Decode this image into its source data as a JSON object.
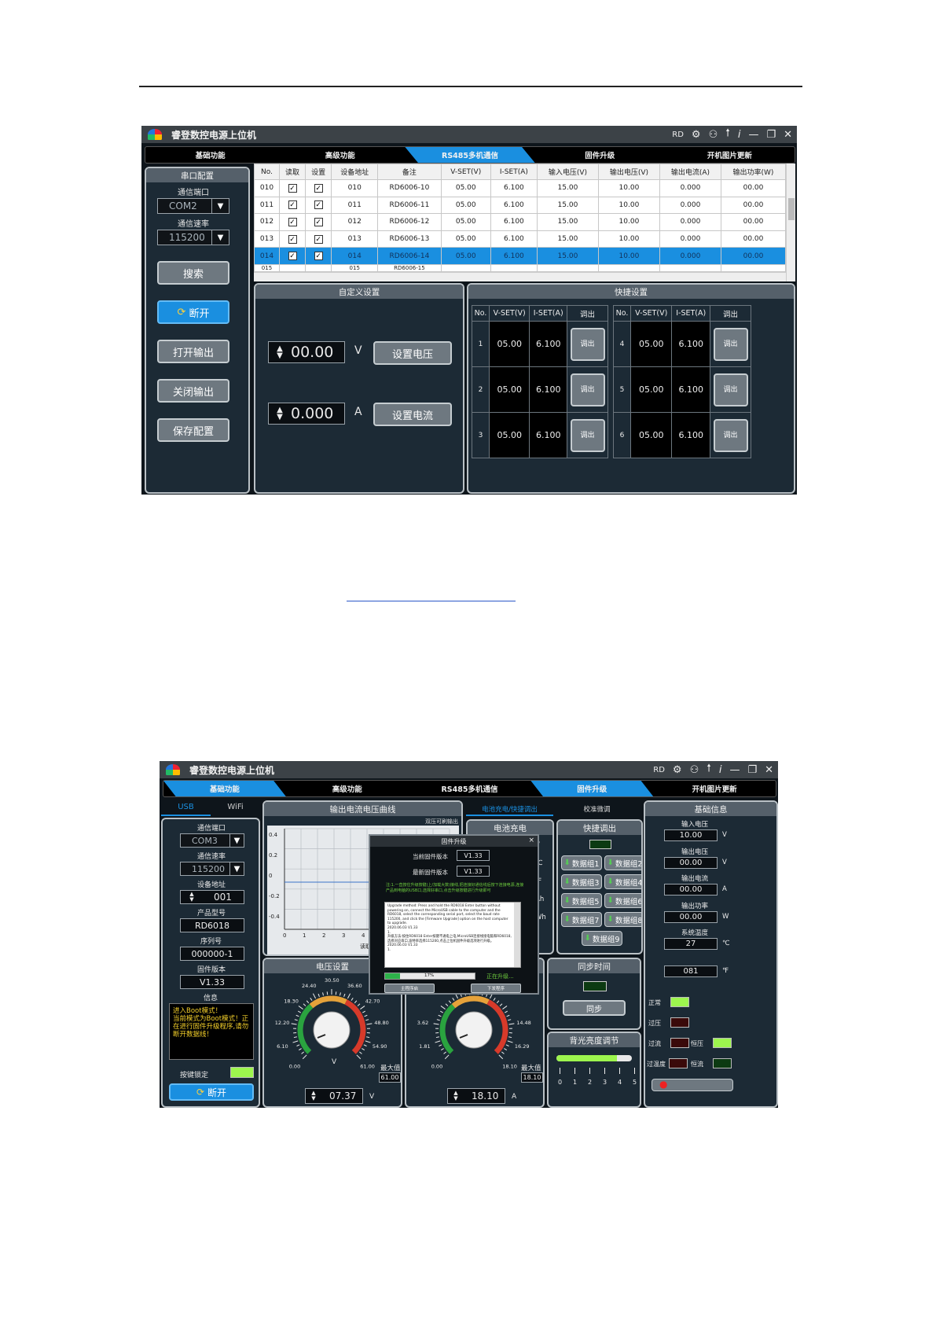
{
  "shot1": {
    "app_title": "睿登数控电源上位机",
    "window_controls": {
      "rd": "RD",
      "settings": "⚙",
      "user": "⚇",
      "upload": "🠕",
      "info": "i",
      "min": "—",
      "restore": "❐",
      "close": "✕"
    },
    "tabs": [
      "基础功能",
      "高级功能",
      "RS485多机通信",
      "固件升级",
      "开机图片更新"
    ],
    "serial": {
      "header": "串口配置",
      "port_label": "通信端口",
      "port_value": "COM2",
      "baud_label": "通信速率",
      "baud_value": "115200",
      "search": "搜索",
      "disconnect": "断开",
      "open_output": "打开输出",
      "close_output": "关闭输出",
      "save_config": "保存配置"
    },
    "grid": {
      "columns": [
        "No.",
        "读取",
        "设置",
        "设备地址",
        "备注",
        "V-SET(V)",
        "I-SET(A)",
        "输入电压(V)",
        "输出电压(V)",
        "输出电流(A)",
        "输出功率(W)"
      ],
      "rows": [
        [
          "010",
          "✓",
          "✓",
          "010",
          "RD6006-10",
          "05.00",
          "6.100",
          "15.00",
          "10.00",
          "0.000",
          "00.00"
        ],
        [
          "011",
          "✓",
          "✓",
          "011",
          "RD6006-11",
          "05.00",
          "6.100",
          "15.00",
          "10.00",
          "0.000",
          "00.00"
        ],
        [
          "012",
          "✓",
          "✓",
          "012",
          "RD6006-12",
          "05.00",
          "6.100",
          "15.00",
          "10.00",
          "0.000",
          "00.00"
        ],
        [
          "013",
          "✓",
          "✓",
          "013",
          "RD6006-13",
          "05.00",
          "6.100",
          "15.00",
          "10.00",
          "0.000",
          "00.00"
        ],
        [
          "014",
          "✓",
          "✓",
          "014",
          "RD6006-14",
          "05.00",
          "6.100",
          "15.00",
          "10.00",
          "0.000",
          "00.00"
        ]
      ],
      "partial_row": [
        "015",
        "",
        "",
        "015",
        "RD6006-15"
      ]
    },
    "custom": {
      "header": "自定义设置",
      "voltage": "00.00",
      "v_unit": "V",
      "set_voltage": "设置电压",
      "current": "0.000",
      "a_unit": "A",
      "set_current": "设置电流"
    },
    "quick": {
      "header": "快捷设置",
      "columns": [
        "No.",
        "V-SET(V)",
        "I-SET(A)",
        "调出"
      ],
      "left": [
        [
          "1",
          "05.00",
          "6.100"
        ],
        [
          "2",
          "05.00",
          "6.100"
        ],
        [
          "3",
          "05.00",
          "6.100"
        ]
      ],
      "right": [
        [
          "4",
          "05.00",
          "6.100"
        ],
        [
          "5",
          "05.00",
          "6.100"
        ],
        [
          "6",
          "05.00",
          "6.100"
        ]
      ],
      "recall": "调出"
    }
  },
  "shot2": {
    "app_title": "睿登数控电源上位机",
    "tabs": [
      "基础功能",
      "高级功能",
      "RS485多机通信",
      "固件升级",
      "开机图片更新"
    ],
    "conn_tabs": [
      "USB",
      "WiFi"
    ],
    "left": {
      "port_label": "通信端口",
      "port": "COM3",
      "baud_label": "通信速率",
      "baud": "115200",
      "addr_label": "设备地址",
      "addr": "001",
      "model_label": "产品型号",
      "model": "RD6018",
      "serial_label": "序列号",
      "serial": "000000-1",
      "fw_label": "固件版本",
      "fw": "V1.33",
      "info_label": "信息",
      "info_text": "进入Boot模式！\n当前模式为Boot模式！正在进行固件升级程序,请勿断开数据线！",
      "lock_label": "按键锁定",
      "disconnect": "断开"
    },
    "curve": {
      "header": "输出电流电压曲线",
      "dual": "双压可刷输出",
      "yticks": [
        "0.4",
        "0.2",
        "0",
        "-0.2",
        "-0.4"
      ],
      "xticks": [
        "0",
        "1",
        "2",
        "3",
        "4"
      ],
      "xlabel": "读取次"
    },
    "mid_tabs": [
      "电池充电/快捷调出",
      "校准微调"
    ],
    "battery": {
      "header": "电池充电",
      "units": [
        "V",
        "℃",
        "℉",
        "Ah",
        "Wh"
      ],
      "prefixes": [
        "0",
        "0"
      ]
    },
    "quick_recall": {
      "header": "快捷调出",
      "groups": [
        "数据组1",
        "数据组2",
        "数据组3",
        "数据组4",
        "数据组5",
        "数据组6",
        "数据组7",
        "数据组8",
        "数据组9"
      ]
    },
    "sync": {
      "header": "同步时间",
      "button": "同步"
    },
    "backlight": {
      "header": "背光亮度调节",
      "ticks": [
        "0",
        "1",
        "2",
        "3",
        "4",
        "5"
      ],
      "level_fraction": 0.8
    },
    "voltage_set": {
      "header": "电压设置",
      "scale": [
        "0.00",
        "6.10",
        "12.20",
        "18.30",
        "24.40",
        "30.50",
        "36.60",
        "42.70",
        "48.80",
        "54.90",
        "61.00"
      ],
      "unit": "V",
      "max_label": "最大值",
      "max": "61.00",
      "value": "07.37",
      "value_unit": "V"
    },
    "current_set": {
      "scale_left": [
        "0.00",
        "1.81",
        "3.62"
      ],
      "scale_right": [
        "14.48",
        "16.29",
        "18.10"
      ],
      "max_label": "最大值",
      "max": "18.10",
      "value": "18.10",
      "unit": "A"
    },
    "base_info": {
      "header": "基础信息",
      "items": [
        {
          "label": "输入电压",
          "value": "10.00",
          "unit": "V"
        },
        {
          "label": "输出电压",
          "value": "00.00",
          "unit": "V"
        },
        {
          "label": "输出电流",
          "value": "00.00",
          "unit": "A"
        },
        {
          "label": "输出功率",
          "value": "00.00",
          "unit": "W"
        },
        {
          "label": "系统温度",
          "value": "27",
          "unit": "℃"
        },
        {
          "label": "",
          "value": "081",
          "unit": "℉"
        }
      ],
      "status": {
        "normal": "正常",
        "ovp": "过压",
        "ocp": "过流",
        "cv": "恒压",
        "otp": "过温度",
        "cc": "恒流"
      }
    },
    "dialog": {
      "title": "固件升级",
      "close": "×",
      "current_label": "当前固件版本",
      "current": "V1.33",
      "latest_label": "最新固件版本",
      "latest": "V1.33",
      "note": "注:1.一直按住升级按键(上/加载大数)接线,把连接好通信线后按下连接电源,连接产品到电脑的USB口,选择好串口,点击升级按键进行升级即可",
      "log": "Upgrade method: Press and hold the RD6018 Enter button without powering on, connect the MicroUSB cable to the computer and the RD6018, select the corresponding serial port, select the baud rate 115200, and click the [Firmware Upgrade] option on the host computer to upgrade.\n2020.06.03 V1.33\n1.\n升级方法:按住RD6018 Enter按键不通电上电,MicroUSB连接线接电脑和RD6018,选择对应串口,波特率选择115200,点击上位机固件升级选项进行升级。\n2020.06.03 V1.33\n1.",
      "progress_fraction": 0.17,
      "progress_label": "17%",
      "status": "正在升级...",
      "btn_left": "主程序启",
      "btn_right": "下发程序"
    }
  }
}
